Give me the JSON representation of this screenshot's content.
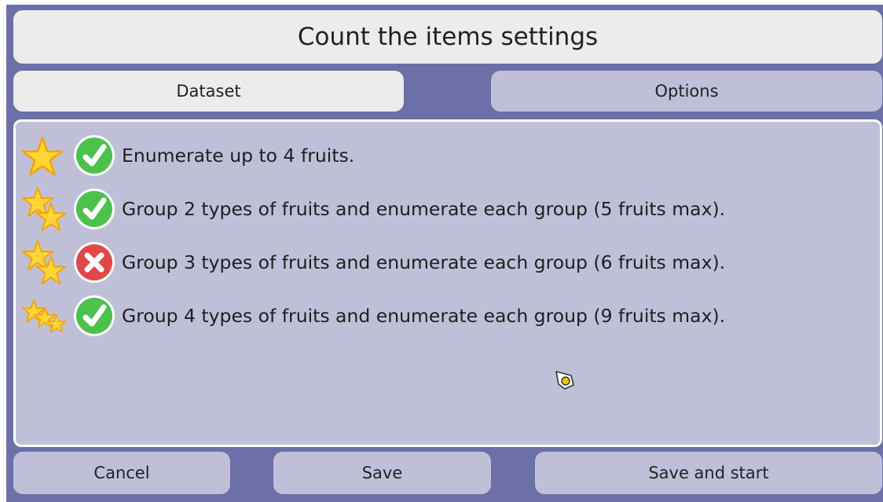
{
  "title": "Count the items settings",
  "tabs": [
    {
      "label": "Dataset",
      "active": true
    },
    {
      "label": "Options",
      "active": false
    }
  ],
  "levels": [
    {
      "stars": 1,
      "enabled": true,
      "label": "Enumerate up to 4 fruits."
    },
    {
      "stars": 2,
      "enabled": true,
      "label": "Group 2 types of fruits and enumerate each group (5 fruits max)."
    },
    {
      "stars": 2,
      "enabled": false,
      "label": "Group 3 types of fruits and enumerate each group (6 fruits max)."
    },
    {
      "stars": 3,
      "enabled": true,
      "label": "Group 4 types of fruits and enumerate each group (9 fruits max)."
    }
  ],
  "footer": {
    "cancel_label": "Cancel",
    "save_label": "Save",
    "save_start_label": "Save and start"
  },
  "colors": {
    "background": "#6c6fa8",
    "panel": "#bfc0d8",
    "enabled_green": "#4cc24c",
    "disabled_red": "#e04848",
    "star_yellow": "#ffd633"
  },
  "icons": {
    "enabled": "check-icon",
    "disabled": "cross-icon",
    "star": "star-icon"
  }
}
